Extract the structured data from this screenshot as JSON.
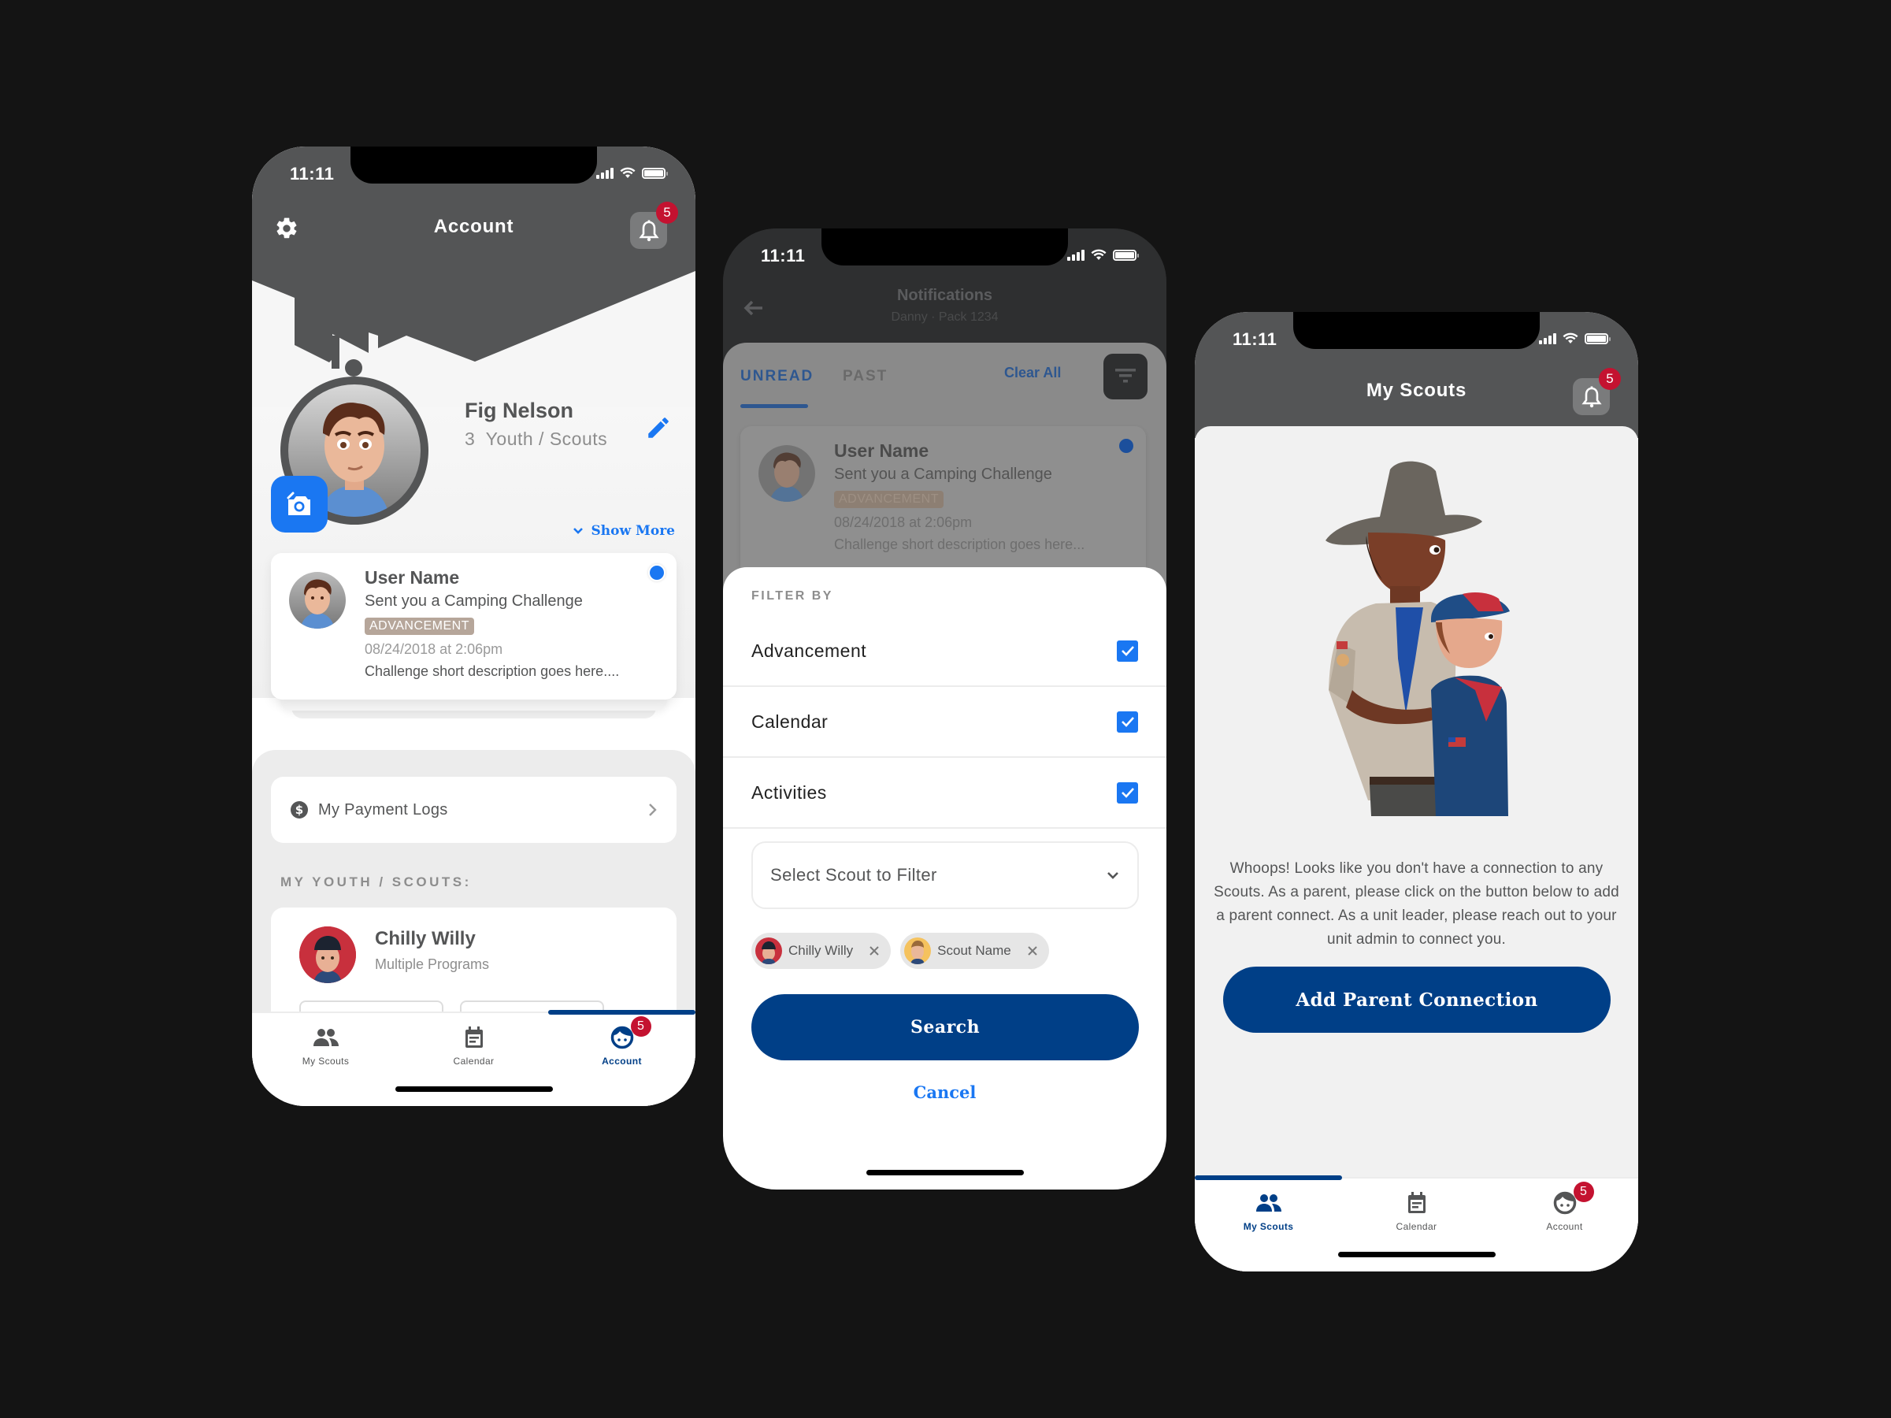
{
  "status_bar": {
    "time": "11:11"
  },
  "colors": {
    "brand_blue": "#003f87",
    "accent_blue": "#1a77f2",
    "header_gray": "#545556",
    "badge_red": "#c41230",
    "tag_tan": "#b6a69a"
  },
  "account_screen": {
    "title": "Account",
    "notification_count": "5",
    "profile": {
      "name": "Fig Nelson",
      "youth_count": "3",
      "youth_label": "Youth / Scouts"
    },
    "show_more_label": "Show More",
    "notification": {
      "user": "User Name",
      "message": "Sent you a Camping Challenge",
      "tag": "ADVANCEMENT",
      "date": "08/24/2018 at 2:06pm",
      "description": "Challenge short description goes here...."
    },
    "payment_logs_label": "My Payment Logs",
    "section_label": "MY YOUTH / SCOUTS:",
    "scouts": [
      {
        "name": "Chilly Willy",
        "programs": "Multiple Programs"
      }
    ]
  },
  "notifications_screen": {
    "title": "Notifications",
    "subtitle": "Danny · Pack 1234",
    "tabs": [
      {
        "label": "UNREAD",
        "active": true
      },
      {
        "label": "PAST",
        "active": false
      }
    ],
    "clear_all_label": "Clear All",
    "notification": {
      "user": "User Name",
      "message": "Sent you a Camping Challenge",
      "tag": "ADVANCEMENT",
      "date": "08/24/2018 at 2:06pm",
      "description": "Challenge short description goes here..."
    },
    "filter_sheet": {
      "label": "FILTER BY",
      "options": [
        {
          "label": "Advancement",
          "checked": true
        },
        {
          "label": "Calendar",
          "checked": true
        },
        {
          "label": "Activities",
          "checked": true
        }
      ],
      "select_placeholder": "Select Scout to Filter",
      "chips": [
        {
          "label": "Chilly Willy"
        },
        {
          "label": "Scout Name"
        }
      ],
      "search_label": "Search",
      "cancel_label": "Cancel"
    }
  },
  "my_scouts_screen": {
    "title": "My Scouts",
    "notification_count": "5",
    "empty_message": "Whoops! Looks like you don't have a connection to any Scouts. As a parent, please click on the button below to add a parent connect. As a unit leader, please reach out to your unit admin to connect you.",
    "add_parent_label": "Add Parent Connection"
  },
  "tabbar": {
    "tabs": [
      {
        "label": "My Scouts",
        "icon": "people-icon"
      },
      {
        "label": "Calendar",
        "icon": "calendar-icon"
      },
      {
        "label": "Account",
        "icon": "face-icon",
        "badge": "5"
      }
    ]
  }
}
